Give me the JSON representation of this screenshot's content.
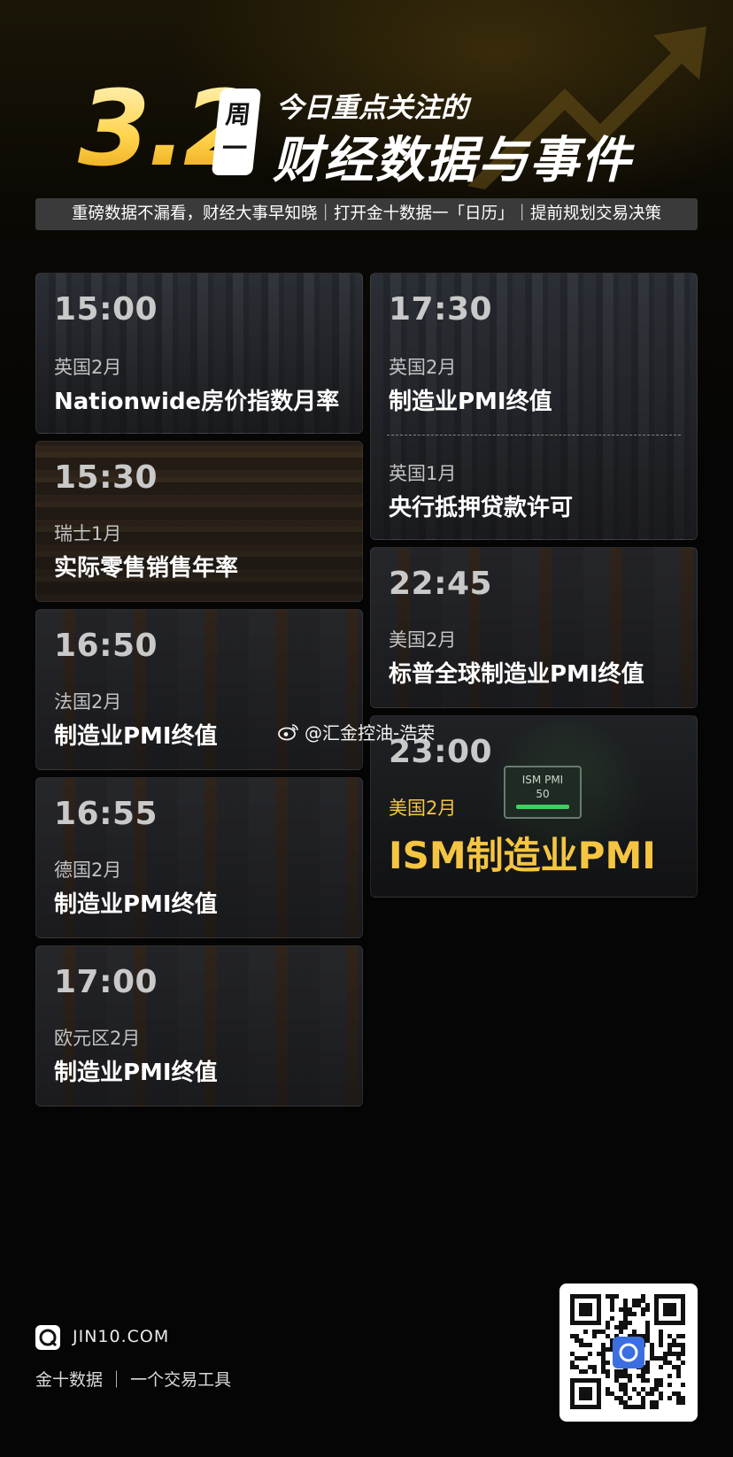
{
  "header": {
    "date": "3.2",
    "weekday_top": "周",
    "weekday_bottom": "一",
    "title_small": "今日重点关注的",
    "title_big": "财经数据与事件",
    "subtitle": "重磅数据不漏看，财经大事早知晓｜打开金十数据一「日历」｜提前规划交易决策"
  },
  "left_cards": [
    {
      "time": "15:00",
      "region": "英国2月",
      "event": "Nationwide房价指数月率"
    },
    {
      "time": "15:30",
      "region": "瑞士1月",
      "event": "实际零售销售年率"
    },
    {
      "time": "16:50",
      "region": "法国2月",
      "event": "制造业PMI终值"
    },
    {
      "time": "16:55",
      "region": "德国2月",
      "event": "制造业PMI终值"
    },
    {
      "time": "17:00",
      "region": "欧元区2月",
      "event": "制造业PMI终值"
    }
  ],
  "right_cards": [
    {
      "time": "17:30",
      "region": "英国2月",
      "event": "制造业PMI终值",
      "region2": "英国1月",
      "event2": "央行抵押贷款许可"
    },
    {
      "time": "22:45",
      "region": "美国2月",
      "event": "标普全球制造业PMI终值"
    },
    {
      "time": "23:00",
      "region": "美国2月",
      "event": "ISM制造业PMI",
      "panel_title": "ISM PMI",
      "panel_value": "50"
    }
  ],
  "watermark": {
    "weibo": "@汇金控油-浩荣"
  },
  "footer": {
    "site": "JIN10.COM",
    "brand": "金十数据 ｜ 一个交易工具"
  },
  "colors": {
    "accent_gold": "#f5c542",
    "background": "#050505"
  }
}
